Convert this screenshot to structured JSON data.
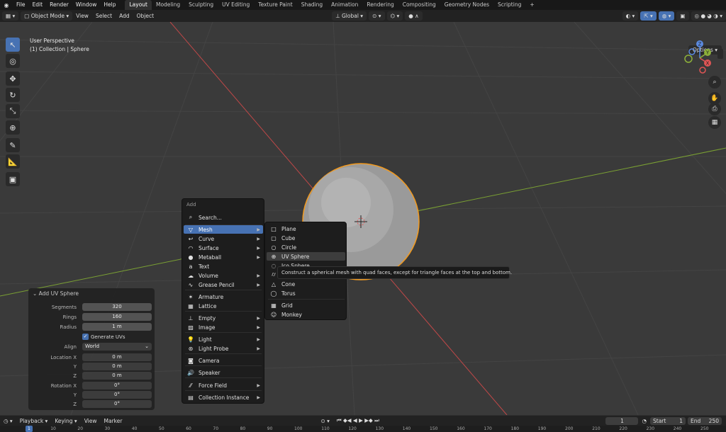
{
  "topbar": {
    "menus": [
      "File",
      "Edit",
      "Render",
      "Window",
      "Help"
    ],
    "workspaces": [
      "Layout",
      "Modeling",
      "Sculpting",
      "UV Editing",
      "Texture Paint",
      "Shading",
      "Animation",
      "Rendering",
      "Compositing",
      "Geometry Nodes",
      "Scripting"
    ],
    "active_workspace": "Layout",
    "add_tab": "+"
  },
  "header": {
    "mode": "Object Mode",
    "menus": [
      "View",
      "Select",
      "Add",
      "Object"
    ],
    "orientation": "Global"
  },
  "viewport": {
    "info_line1": "User Perspective",
    "info_line2": "(1) Collection | Sphere",
    "options_label": "Options",
    "gizmo": {
      "x": "X",
      "y": "Y",
      "z": "Z"
    }
  },
  "operator_panel": {
    "title": "Add UV Sphere",
    "segments_label": "Segments",
    "segments": "320",
    "rings_label": "Rings",
    "rings": "160",
    "radius_label": "Radius",
    "radius": "1 m",
    "generate_uvs": "Generate UVs",
    "align_label": "Align",
    "align": "World",
    "location_label": "Location X",
    "loc_y_label": "Y",
    "loc_z_label": "Z",
    "location": [
      "0 m",
      "0 m",
      "0 m"
    ],
    "rotation_label": "Rotation X",
    "rot_y_label": "Y",
    "rot_z_label": "Z",
    "rotation": [
      "0°",
      "0°",
      "0°"
    ]
  },
  "add_menu": {
    "title": "Add",
    "search": "Search...",
    "items": {
      "mesh": "Mesh",
      "curve": "Curve",
      "surface": "Surface",
      "metaball": "Metaball",
      "text": "Text",
      "volume": "Volume",
      "grease_pencil": "Grease Pencil",
      "armature": "Armature",
      "lattice": "Lattice",
      "empty": "Empty",
      "image": "Image",
      "light": "Light",
      "light_probe": "Light Probe",
      "camera": "Camera",
      "speaker": "Speaker",
      "force_field": "Force Field",
      "collection_instance": "Collection Instance"
    }
  },
  "mesh_menu": {
    "plane": "Plane",
    "cube": "Cube",
    "circle": "Circle",
    "uv_sphere": "UV Sphere",
    "ico_sphere": "Ico Sphere",
    "cone": "Cone",
    "torus": "Torus",
    "grid": "Grid",
    "monkey": "Monkey"
  },
  "tooltip": "Construct a spherical mesh with quad faces, except for triangle faces at the top and bottom.",
  "timeline": {
    "playback": "Playback",
    "keying": "Keying",
    "view": "View",
    "marker": "Marker",
    "current_frame": "1",
    "start_label": "Start",
    "start": "1",
    "end_label": "End",
    "end": "250",
    "ruler": [
      "1",
      "10",
      "20",
      "30",
      "40",
      "50",
      "60",
      "70",
      "80",
      "90",
      "100",
      "110",
      "120",
      "130",
      "140",
      "150",
      "160",
      "170",
      "180",
      "190",
      "200",
      "210",
      "220",
      "230",
      "240",
      "250"
    ]
  },
  "colors": {
    "accent": "#4772b3",
    "selection_outline": "#f29a1f",
    "axis_x": "#e05555",
    "axis_y": "#8db13a"
  }
}
